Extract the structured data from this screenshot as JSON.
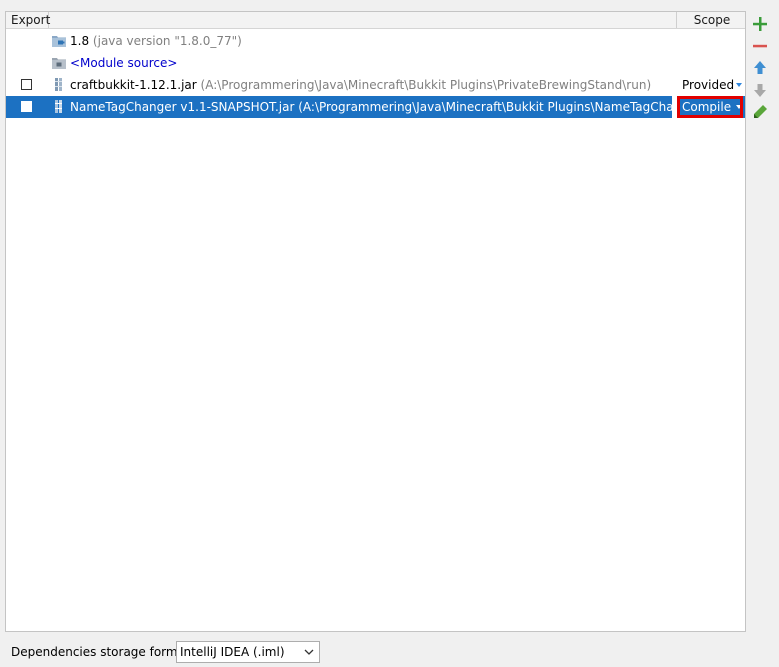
{
  "table": {
    "columns": {
      "export": "Export",
      "scope": "Scope"
    },
    "rows": [
      {
        "name": "1.8",
        "hint": "(java version \"1.8.0_77\")",
        "icon": "jdk-folder-icon",
        "has_checkbox": false,
        "scope": ""
      },
      {
        "name": "<Module source>",
        "hint": "",
        "icon": "module-source-folder-icon",
        "has_checkbox": false,
        "scope": ""
      },
      {
        "name": "craftbukkit-1.12.1.jar",
        "hint": "(A:\\Programmering\\Java\\Minecraft\\Bukkit Plugins\\PrivateBrewingStand\\run)",
        "icon": "jar-library-icon",
        "has_checkbox": true,
        "scope": "Provided"
      },
      {
        "name": "NameTagChanger v1.1-SNAPSHOT.jar",
        "hint": "(A:\\Programmering\\Java\\Minecraft\\Bukkit Plugins\\NameTagChanger\\targe",
        "icon": "jar-library-icon",
        "has_checkbox": true,
        "scope": "Compile",
        "selected": true
      }
    ]
  },
  "toolbar": {
    "add_icon": "plus-icon",
    "remove_icon": "minus-icon",
    "move_up_icon": "arrow-up-icon",
    "move_down_icon": "arrow-down-icon",
    "edit_icon": "pencil-icon"
  },
  "footer": {
    "label": "Dependencies storage format:",
    "format_value": "IntelliJ IDEA (.iml)"
  },
  "colors": {
    "selection": "#1c71c2",
    "highlight_box": "#e10000",
    "add": "#3a9c3a",
    "remove": "#d9534f",
    "arrow_up": "#3f8fd2",
    "arrow_down": "#a8a8a8"
  }
}
